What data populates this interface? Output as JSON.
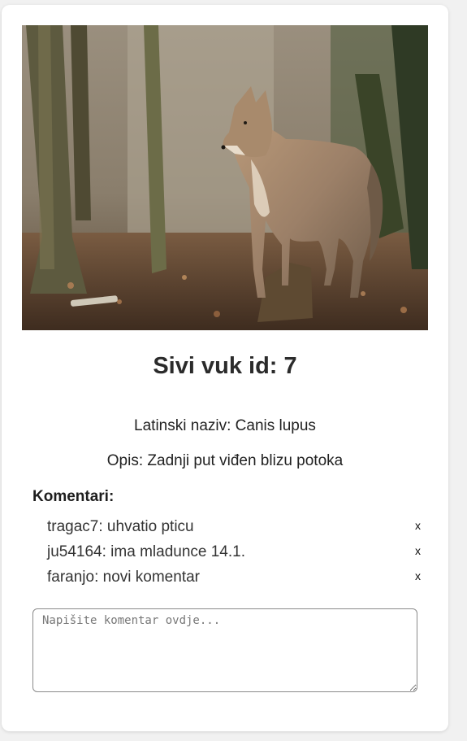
{
  "animal": {
    "title": "Sivi vuk id: 7",
    "latin_name": "Latinski naziv: Canis lupus",
    "description": "Opis: Zadnji put viđen blizu potoka",
    "image_subject": "grey wolf standing in autumn forest"
  },
  "comments": {
    "heading": "Komentari:",
    "delete_label": "x",
    "items": [
      {
        "text": "tragac7: uhvatio pticu"
      },
      {
        "text": "ju54164: ima mladunce 14.1."
      },
      {
        "text": "faranjo: novi komentar"
      }
    ]
  },
  "comment_form": {
    "placeholder": "Napišite komentar ovdje..."
  },
  "colors": {
    "page_background": "#f1f1f1",
    "card_background": "#ffffff",
    "title": "#2b2b2b"
  }
}
